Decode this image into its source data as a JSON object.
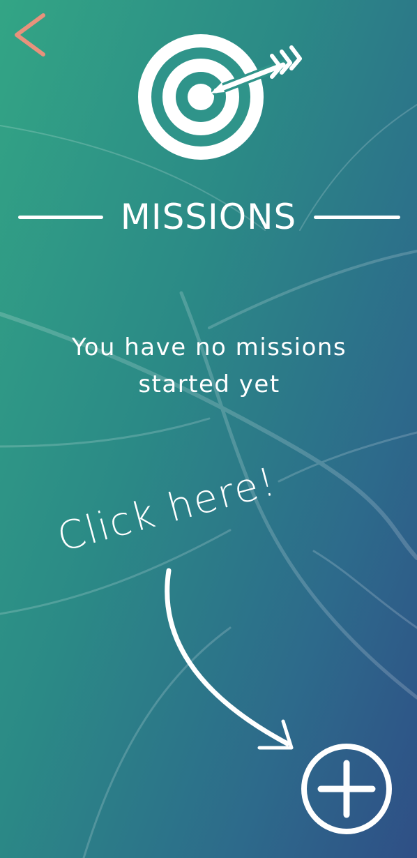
{
  "header": {
    "back_icon": "chevron-left-icon",
    "mission_icon": "target-arrow-icon",
    "title": "MISSIONS"
  },
  "empty_state": {
    "message_line1": "You have no missions",
    "message_line2": "started yet"
  },
  "hint": {
    "text": "Click here!",
    "arrow_icon": "curved-arrow-icon"
  },
  "actions": {
    "add_icon": "plus-circle-icon"
  },
  "colors": {
    "back": "#e8927c",
    "foreground": "#ffffff",
    "gradient_start": "#33a585",
    "gradient_end": "#2f4f86"
  }
}
